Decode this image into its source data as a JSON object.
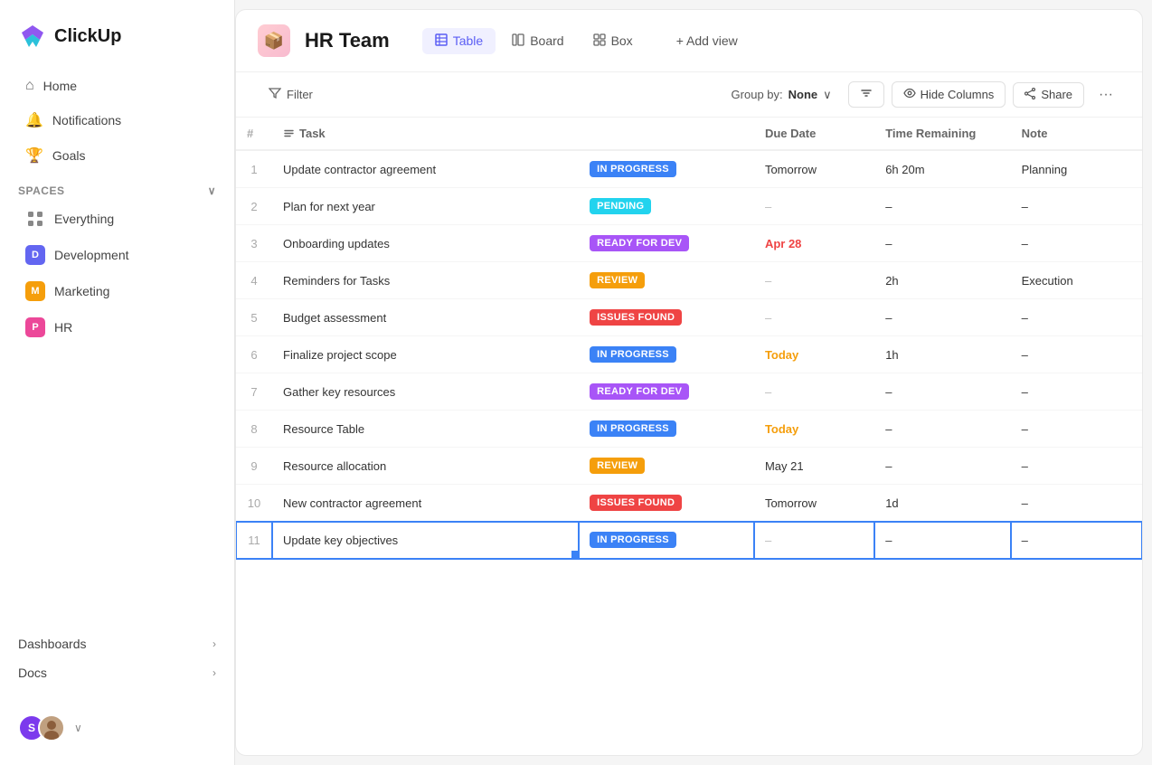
{
  "app": {
    "name": "ClickUp"
  },
  "sidebar": {
    "nav": [
      {
        "id": "home",
        "label": "Home",
        "icon": "⌂"
      },
      {
        "id": "notifications",
        "label": "Notifications",
        "icon": "🔔"
      },
      {
        "id": "goals",
        "label": "Goals",
        "icon": "🏆"
      }
    ],
    "spaces_label": "Spaces",
    "spaces": [
      {
        "id": "everything",
        "label": "Everything",
        "type": "everything"
      },
      {
        "id": "development",
        "label": "Development",
        "type": "badge",
        "color": "#6366f1",
        "letter": "D"
      },
      {
        "id": "marketing",
        "label": "Marketing",
        "type": "badge",
        "color": "#f59e0b",
        "letter": "M"
      },
      {
        "id": "hr",
        "label": "HR",
        "type": "badge",
        "color": "#ec4899",
        "letter": "P"
      }
    ],
    "bottom_items": [
      {
        "id": "dashboards",
        "label": "Dashboards"
      },
      {
        "id": "docs",
        "label": "Docs"
      }
    ],
    "user": {
      "initials": "S",
      "avatar_color": "#7c3aed"
    }
  },
  "header": {
    "space_icon": "📦",
    "title": "HR Team",
    "views": [
      {
        "id": "table",
        "label": "Table",
        "icon": "⊞",
        "active": true
      },
      {
        "id": "board",
        "label": "Board",
        "icon": "▦"
      },
      {
        "id": "box",
        "label": "Box",
        "icon": "⊟"
      }
    ],
    "add_view_label": "+ Add view"
  },
  "toolbar": {
    "filter_label": "Filter",
    "group_by_label": "Group by:",
    "group_value": "None",
    "sort_icon": "sort",
    "hide_columns_label": "Hide Columns",
    "share_label": "Share"
  },
  "table": {
    "columns": [
      "#",
      "Task",
      "",
      "Due Date",
      "Time Remaining",
      "Note"
    ],
    "rows": [
      {
        "num": 1,
        "task": "Update contractor agreement",
        "status": "IN PROGRESS",
        "status_class": "badge-in-progress",
        "due": "Tomorrow",
        "due_class": "",
        "time": "6h 20m",
        "note": "Planning"
      },
      {
        "num": 2,
        "task": "Plan for next year",
        "status": "PENDING",
        "status_class": "badge-pending",
        "due": "–",
        "due_class": "due-dash",
        "time": "–",
        "note": "–"
      },
      {
        "num": 3,
        "task": "Onboarding updates",
        "status": "READY FOR DEV",
        "status_class": "badge-ready-for-dev",
        "due": "Apr 28",
        "due_class": "due-apr",
        "time": "–",
        "note": "–"
      },
      {
        "num": 4,
        "task": "Reminders for Tasks",
        "status": "REVIEW",
        "status_class": "badge-review",
        "due": "–",
        "due_class": "due-dash",
        "time": "2h",
        "note": "Execution"
      },
      {
        "num": 5,
        "task": "Budget assessment",
        "status": "ISSUES FOUND",
        "status_class": "badge-issues-found",
        "due": "–",
        "due_class": "due-dash",
        "time": "–",
        "note": "–"
      },
      {
        "num": 6,
        "task": "Finalize project scope",
        "status": "IN PROGRESS",
        "status_class": "badge-in-progress",
        "due": "Today",
        "due_class": "due-today",
        "time": "1h",
        "note": "–"
      },
      {
        "num": 7,
        "task": "Gather key resources",
        "status": "READY FOR DEV",
        "status_class": "badge-ready-for-dev",
        "due": "–",
        "due_class": "due-dash",
        "time": "–",
        "note": "–"
      },
      {
        "num": 8,
        "task": "Resource Table",
        "status": "IN PROGRESS",
        "status_class": "badge-in-progress",
        "due": "Today",
        "due_class": "due-today",
        "time": "–",
        "note": "–"
      },
      {
        "num": 9,
        "task": "Resource allocation",
        "status": "REVIEW",
        "status_class": "badge-review",
        "due": "May 21",
        "due_class": "",
        "time": "–",
        "note": "–"
      },
      {
        "num": 10,
        "task": "New contractor agreement",
        "status": "ISSUES FOUND",
        "status_class": "badge-issues-found",
        "due": "Tomorrow",
        "due_class": "",
        "time": "1d",
        "note": "–"
      },
      {
        "num": 11,
        "task": "Update key objectives",
        "status": "IN PROGRESS",
        "status_class": "badge-in-progress",
        "due": "–",
        "due_class": "due-dash",
        "time": "–",
        "note": "–",
        "selected": true
      }
    ]
  }
}
